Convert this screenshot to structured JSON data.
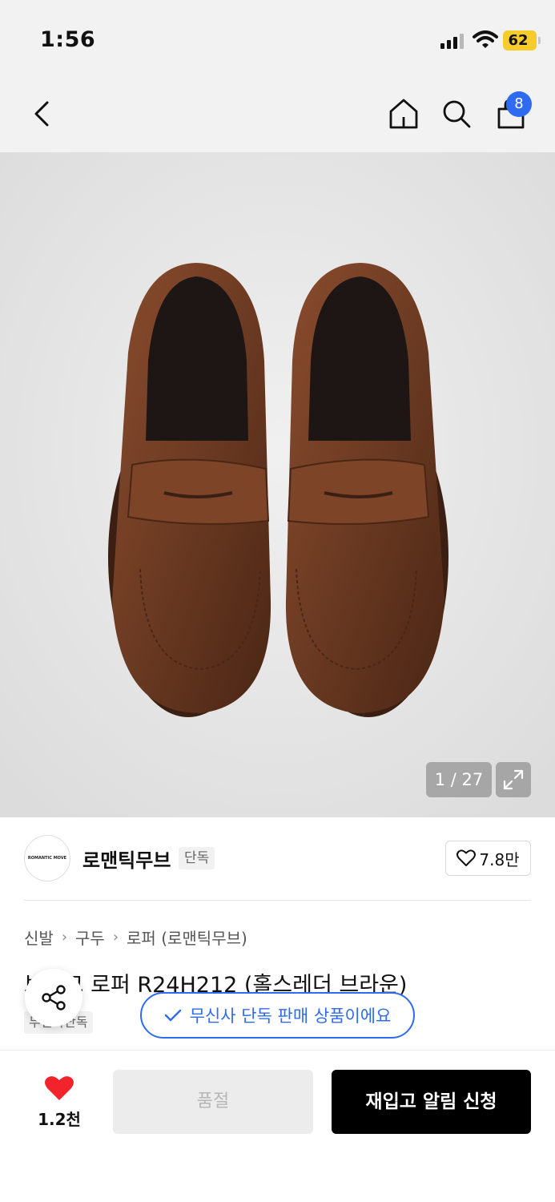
{
  "status_bar": {
    "time": "1:56",
    "battery": "62"
  },
  "header": {
    "cart_count": "8"
  },
  "gallery": {
    "counter": "1 / 27"
  },
  "brand": {
    "logo_text": "ROMANTIC MOVE",
    "name": "로맨틱무브",
    "tag": "단독",
    "like_count": "7.8만"
  },
  "breadcrumb": {
    "items": [
      "신발",
      "구두",
      "로퍼 (로맨틱무브)"
    ]
  },
  "product": {
    "title": "브리그 로퍼 R24H212 (홀스레더 브라운)",
    "tag": "무신사단독"
  },
  "notice": {
    "text": "무신사 단독 판매 상품이에요"
  },
  "bottom": {
    "wish_count": "1.2천",
    "soldout_label": "품절",
    "restock_label": "재입고 알림 신청"
  },
  "colors": {
    "accent": "#2f6bf0",
    "heart": "#f2232b",
    "battery": "#f5cc2b",
    "shoe": "#6b3a22"
  }
}
